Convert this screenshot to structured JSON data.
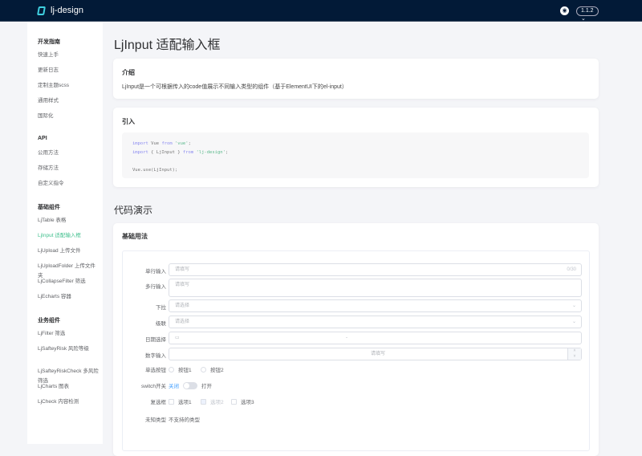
{
  "header": {
    "brand": "lj-design",
    "version": "1.1.2",
    "github_icon": "github-icon"
  },
  "sidebar": {
    "groups": [
      {
        "title": "开发指南",
        "items": [
          "快速上手",
          "更新日志",
          "定制主题scss",
          "通用样式",
          "国际化"
        ]
      },
      {
        "title": "API",
        "items": [
          "公用方法",
          "存储方法",
          "自定义指令"
        ]
      },
      {
        "title": "基础组件",
        "items": [
          "LjTable 表格",
          "LjInput 适配输入框",
          "LjUpload 上传文件",
          "LjUploadFolder 上传文件夹",
          "LjCollapseFilter 筛选",
          "LjEcharts 容器"
        ]
      },
      {
        "title": "业务组件",
        "items": [
          "LjFilter 筛选",
          "LjSafteyRisk 风险等级",
          "LjSafteyRiskCheck 多风险筛选",
          "LjCharts 图表",
          "LjCheck 内容检测"
        ]
      }
    ],
    "active": "LjInput 适配输入框"
  },
  "page": {
    "title": "LjInput 适配输入框",
    "intro": {
      "title": "介绍",
      "text": "LjInput是一个可根据传入的code值展示不同输入类型的组件（基于ElementUI下的el-input）"
    },
    "import": {
      "title": "引入",
      "line1_kw": "import",
      "line1_a": " Vue ",
      "line1_from": "from",
      "line1_str": " 'vue'",
      "line1_end": ";",
      "line2_kw": "import",
      "line2_a": " { LjInput } ",
      "line2_from": "from",
      "line2_str": " 'lj-design'",
      "line2_end": ";",
      "line3": "Vue.use(LjInput);"
    },
    "demo_heading": "代码演示",
    "basic": {
      "title": "基础用法",
      "single": {
        "label": "单行输入",
        "placeholder": "请填写",
        "count": "0/30"
      },
      "multi": {
        "label": "多行输入",
        "placeholder": "请填写"
      },
      "select": {
        "label": "下拉",
        "placeholder": "请选择"
      },
      "cascader": {
        "label": "级联",
        "placeholder": "请选择"
      },
      "date": {
        "label": "日期选择",
        "separator": "-"
      },
      "number": {
        "label": "数字输入",
        "placeholder": "请填写"
      },
      "radio": {
        "label": "单选按钮",
        "options": [
          "按钮1",
          "按钮2"
        ]
      },
      "switch": {
        "label": "switch开关",
        "off": "关闭",
        "on": "打开"
      },
      "checkbox": {
        "label": "复选框",
        "options": [
          "选项1",
          "选项2",
          "选项3"
        ]
      },
      "unknown": {
        "label": "未知类型",
        "text": "不支持的类型"
      }
    }
  },
  "colors": {
    "header": "#021a37",
    "active": "#3ebf8c",
    "link": "#409eff"
  }
}
